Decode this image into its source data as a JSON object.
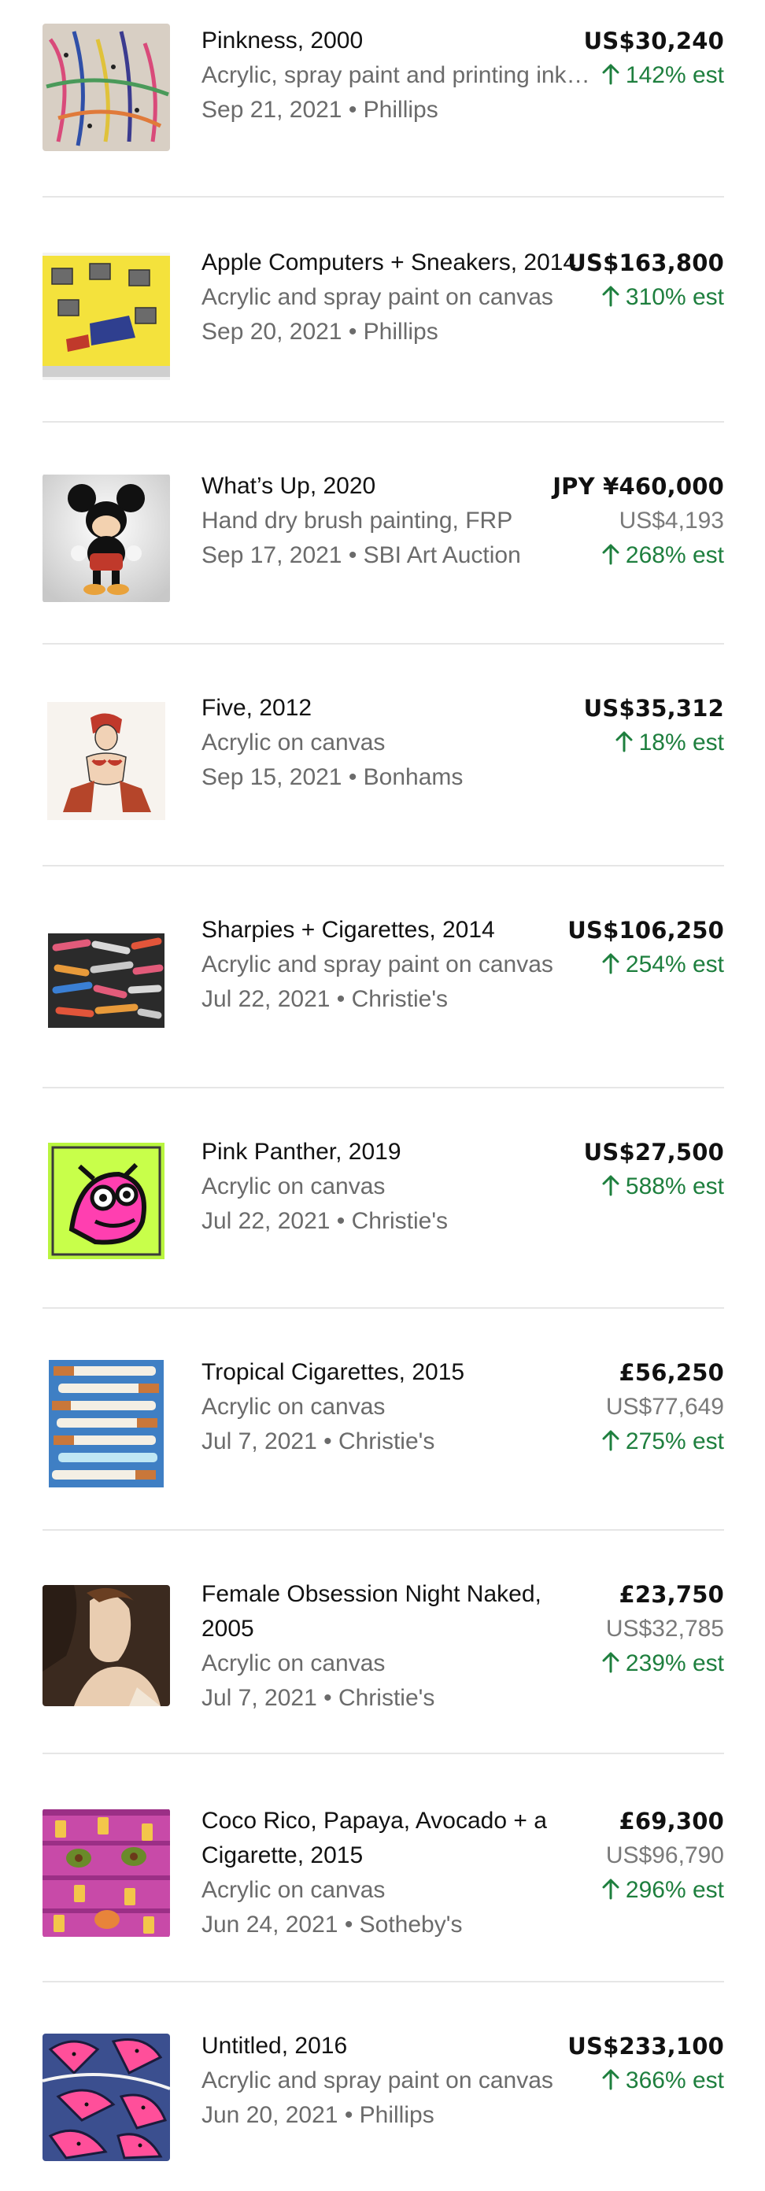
{
  "colors": {
    "accent_green": "#1e7f3e",
    "secondary_text": "#6b6b6b",
    "divider": "#e6e6e6"
  },
  "icons": {
    "estimate": "arrow-up-icon"
  },
  "sales": [
    {
      "title": "Pinkness, 2000",
      "medium": "Acrylic, spray paint and printing ink on canvas",
      "meta": "Sep 21, 2021 • Phillips",
      "price": "US$30,240",
      "usd_price": "",
      "estimate": "142% est",
      "thumbnail": "pinkness-thumbnail"
    },
    {
      "title": "Apple Computers + Sneakers, 2014",
      "medium": "Acrylic and spray paint on canvas",
      "meta": "Sep 20, 2021 • Phillips",
      "price": "US$163,800",
      "usd_price": "",
      "estimate": "310% est",
      "thumbnail": "apple-computers-thumbnail"
    },
    {
      "title": "What’s Up, 2020",
      "medium": "Hand dry brush painting, FRP",
      "meta": "Sep 17, 2021 • SBI Art Auction",
      "price": "JPY ¥460,000",
      "usd_price": "US$4,193",
      "estimate": "268% est",
      "thumbnail": "whats-up-thumbnail"
    },
    {
      "title": "Five, 2012",
      "medium": "Acrylic on canvas",
      "meta": "Sep 15, 2021 • Bonhams",
      "price": "US$35,312",
      "usd_price": "",
      "estimate": "18% est",
      "thumbnail": "five-thumbnail"
    },
    {
      "title": "Sharpies + Cigarettes, 2014",
      "medium": "Acrylic and spray paint on canvas",
      "meta": "Jul 22, 2021 • Christie's",
      "price": "US$106,250",
      "usd_price": "",
      "estimate": "254% est",
      "thumbnail": "sharpies-thumbnail"
    },
    {
      "title": "Pink Panther, 2019",
      "medium": "Acrylic on canvas",
      "meta": "Jul 22, 2021 • Christie's",
      "price": "US$27,500",
      "usd_price": "",
      "estimate": "588% est",
      "thumbnail": "pink-panther-thumbnail"
    },
    {
      "title": "Tropical Cigarettes, 2015",
      "medium": "Acrylic on canvas",
      "meta": "Jul 7, 2021 • Christie's",
      "price": "£56,250",
      "usd_price": "US$77,649",
      "estimate": "275% est",
      "thumbnail": "tropical-cigarettes-thumbnail"
    },
    {
      "title": "Female Obsession Night Naked, 2005",
      "medium": "Acrylic on canvas",
      "meta": "Jul 7, 2021 • Christie's",
      "price": "£23,750",
      "usd_price": "US$32,785",
      "estimate": "239% est",
      "thumbnail": "female-obsession-thumbnail"
    },
    {
      "title": "Coco Rico, Papaya, Avocado + a Cigarette, 2015",
      "medium": "Acrylic on canvas",
      "meta": "Jun 24, 2021 • Sotheby's",
      "price": "£69,300",
      "usd_price": "US$96,790",
      "estimate": "296% est",
      "thumbnail": "coco-rico-thumbnail"
    },
    {
      "title": "Untitled, 2016",
      "medium": "Acrylic and spray paint on canvas",
      "meta": "Jun 20, 2021 • Phillips",
      "price": "US$233,100",
      "usd_price": "",
      "estimate": "366% est",
      "thumbnail": "untitled-thumbnail"
    }
  ]
}
